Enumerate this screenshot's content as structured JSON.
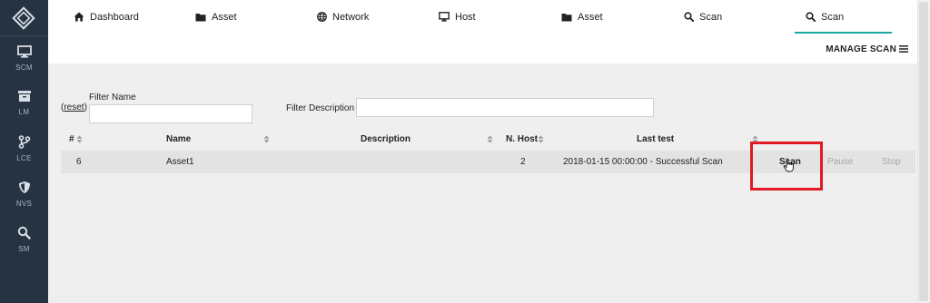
{
  "sidebar": {
    "items": [
      {
        "label": "SCM",
        "icon": "monitor-icon"
      },
      {
        "label": "LM",
        "icon": "archive-icon"
      },
      {
        "label": "LCE",
        "icon": "branch-icon"
      },
      {
        "label": "NVS",
        "icon": "shield-icon"
      },
      {
        "label": "SM",
        "icon": "search-icon"
      }
    ]
  },
  "tabs": [
    {
      "label": "Dashboard",
      "icon": "home-icon"
    },
    {
      "label": "Asset",
      "icon": "folder-icon"
    },
    {
      "label": "Network",
      "icon": "globe-icon"
    },
    {
      "label": "Host",
      "icon": "monitor-icon"
    },
    {
      "label": "Asset",
      "icon": "folder-icon"
    },
    {
      "label": "Scan",
      "icon": "search-icon"
    },
    {
      "label": "Scan",
      "icon": "search-icon",
      "active": true
    }
  ],
  "manage_label": "MANAGE SCAN",
  "filters": {
    "reset_label": "reset",
    "name_label": "Filter Name",
    "name_value": "",
    "description_label": "Filter Description",
    "description_value": ""
  },
  "table": {
    "headers": [
      "#",
      "Name",
      "Description",
      "N. Host",
      "Last test"
    ],
    "rows": [
      {
        "id": "6",
        "name": "Asset1",
        "description": "",
        "hosts": "2",
        "last_test": "2018-01-15 00:00:00 - Successful Scan",
        "actions": [
          "Scan",
          "Pause",
          "Stop"
        ]
      }
    ]
  },
  "colors": {
    "sidebar": "#253342",
    "active_tab_underline": "#18a6a0",
    "highlight_box": "#e01b24",
    "row_bg": "#e3e3e3"
  }
}
